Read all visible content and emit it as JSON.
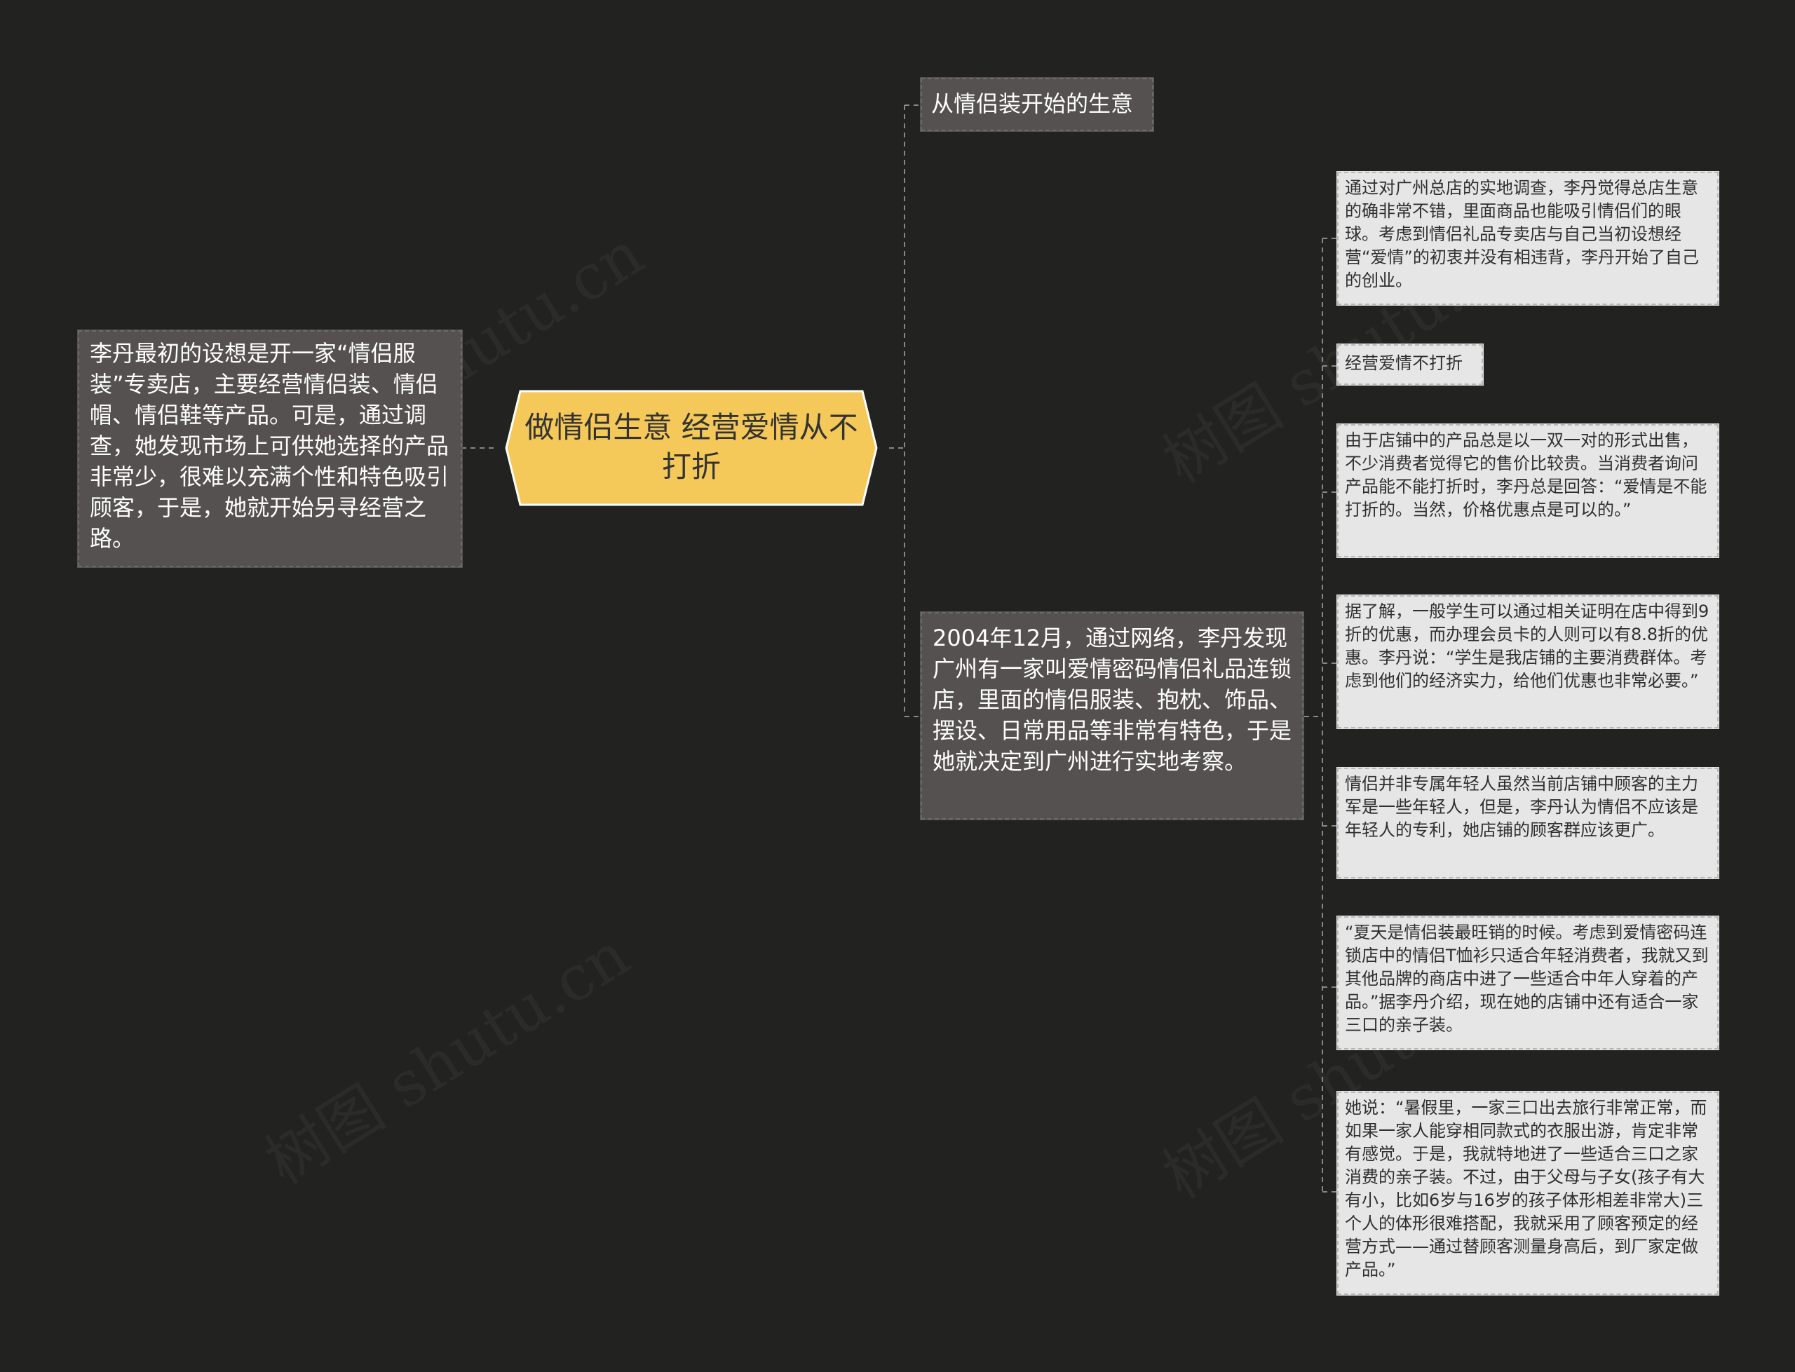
{
  "root": {
    "text": "做情侣生意 经营爱情从不打折"
  },
  "left_branch": {
    "text": "李丹最初的设想是开一家“情侣服装”专卖店，主要经营情侣装、情侣帽、情侣鞋等产品。可是，通过调查，她发现市场上可供她选择的产品非常少，很难以充满个性和特色吸引顾客，于是，她就开始另寻经营之路。"
  },
  "right_branches": [
    {
      "text": "从情侣装开始的生意"
    },
    {
      "text": "2004年12月，通过网络，李丹发现广州有一家叫爱情密码情侣礼品连锁店，里面的情侣服装、抱枕、饰品、摆设、日常用品等非常有特色，于是她就决定到广州进行实地考察。"
    }
  ],
  "details": [
    {
      "text": "通过对广州总店的实地调查，李丹觉得总店生意的确非常不错，里面商品也能吸引情侣们的眼球。考虑到情侣礼品专卖店与自己当初设想经营“爱情”的初衷并没有相违背，李丹开始了自己的创业。"
    },
    {
      "text": "经营爱情不打折"
    },
    {
      "text": "由于店铺中的产品总是以一双一对的形式出售，不少消费者觉得它的售价比较贵。当消费者询问产品能不能打折时，李丹总是回答：“爱情是不能打折的。当然，价格优惠点是可以的。”"
    },
    {
      "text": "据了解，一般学生可以通过相关证明在店中得到9折的优惠，而办理会员卡的人则可以有8.8折的优惠。李丹说：“学生是我店铺的主要消费群体。考虑到他们的经济实力，给他们优惠也非常必要。”"
    },
    {
      "text": "情侣并非专属年轻人虽然当前店铺中顾客的主力军是一些年轻人，但是，李丹认为情侣不应该是年轻人的专利，她店铺的顾客群应该更广。"
    },
    {
      "text": "“夏天是情侣装最旺销的时候。考虑到爱情密码连锁店中的情侣T恤衫只适合年轻消费者，我就又到其他品牌的商店中进了一些适合中年人穿着的产品。”据李丹介绍，现在她的店铺中还有适合一家三口的亲子装。"
    },
    {
      "text": "她说：“暑假里，一家三口出去旅行非常正常，而如果一家人能穿相同款式的衣服出游，肯定非常有感觉。于是，我就特地进了一些适合三口之家消费的亲子装。不过，由于父母与子女(孩子有大有小，比如6岁与16岁的孩子体形相差非常大)三个人的体形很难搭配，我就采用了顾客预定的经营方式——通过替顾客测量身高后，到厂家定做产品。”"
    }
  ],
  "watermark": "树图 shutu.cn",
  "colors": {
    "background": "#222220",
    "root_fill": "#f4c95a",
    "dark_node": "#545150",
    "light_node": "#e6e6e6",
    "connector": "#8a8784"
  }
}
